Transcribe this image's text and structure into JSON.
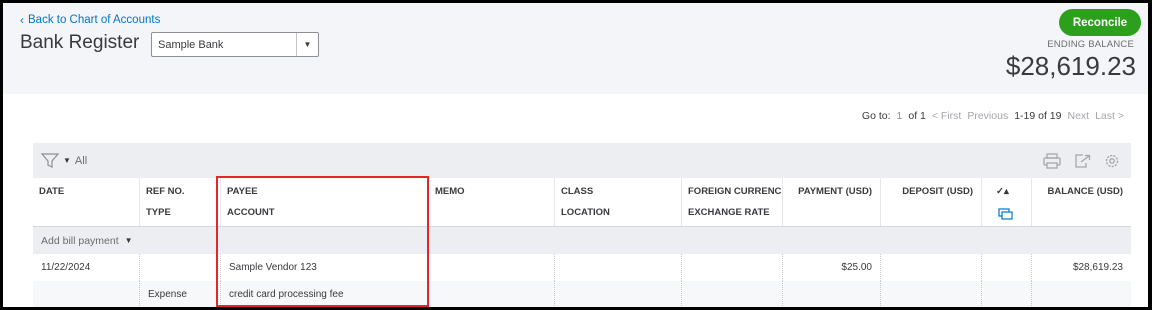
{
  "header": {
    "back_link": "Back to Chart of Accounts",
    "title": "Bank Register",
    "account_selected": "Sample Bank",
    "reconcile_label": "Reconcile",
    "ending_balance_label": "ENDING BALANCE",
    "ending_balance_value": "$28,619.23"
  },
  "pager": {
    "goto_label": "Go to:",
    "goto_value": "1",
    "of_label": "of 1",
    "first": "< First",
    "previous": "Previous",
    "range": "1-19 of 19",
    "next": "Next",
    "last": "Last >"
  },
  "toolbar": {
    "filter_label": "All",
    "icons": [
      "filter-icon",
      "print-icon",
      "export-icon",
      "settings-icon"
    ]
  },
  "table": {
    "headers": {
      "date": "DATE",
      "ref_no": "REF NO.",
      "type": "TYPE",
      "payee": "PAYEE",
      "account": "ACCOUNT",
      "memo": "MEMO",
      "class": "CLASS",
      "location": "LOCATION",
      "foreign_currency": "FOREIGN CURRENC",
      "exchange_rate": "EXCHANGE RATE",
      "payment": "PAYMENT (USD)",
      "deposit": "DEPOSIT (USD)",
      "check": "✓▴",
      "balance": "BALANCE (USD)"
    },
    "add_row_label": "Add bill payment",
    "rows": [
      {
        "date": "11/22/2024",
        "ref_no": "",
        "type": "Expense",
        "payee": "Sample Vendor 123",
        "account": "credit card processing fee",
        "memo": "",
        "class": "",
        "location": "",
        "payment": "$25.00",
        "deposit": "",
        "balance": "$28,619.23"
      }
    ]
  },
  "colors": {
    "accent_green": "#2ca01c",
    "link_blue": "#0077c5",
    "highlight_red": "#e3262b"
  }
}
